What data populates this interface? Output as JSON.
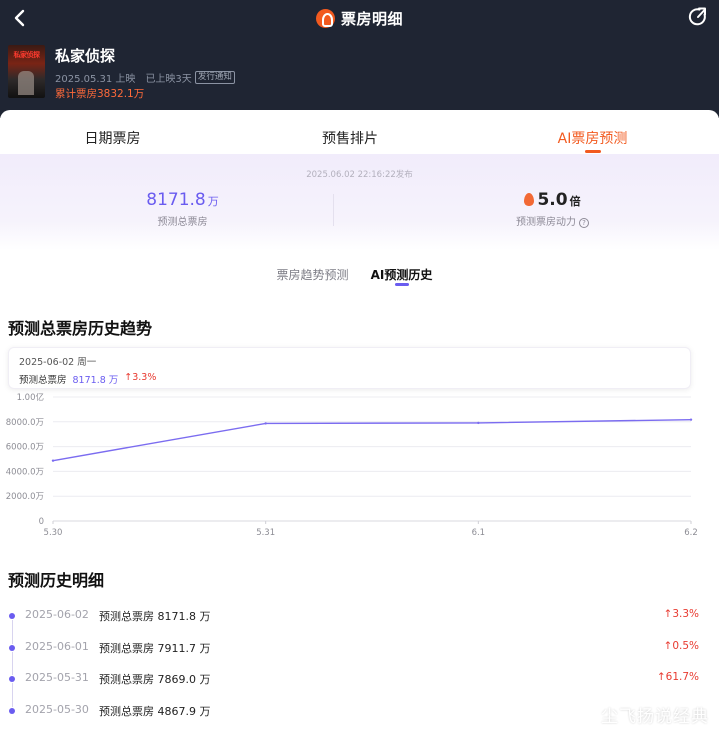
{
  "header": {
    "title": "票房明细",
    "back_icon": "chevron-left-icon",
    "share_icon": "refresh-share-icon",
    "logo_icon": "box-office-logo-icon"
  },
  "movie": {
    "poster_text": "私家侦探",
    "name": "私家侦探",
    "release": "2025.05.31 上映",
    "days": "已上映3天",
    "badge": "发行通知",
    "total": "累计票房3832.1万"
  },
  "tabs": [
    {
      "label": "日期票房",
      "active": false
    },
    {
      "label": "预售排片",
      "active": false
    },
    {
      "label": "AI票房预测",
      "active": true
    }
  ],
  "forecast": {
    "publish_time": "2025.06.02 22:16:22发布",
    "total_value": "8171.8",
    "total_unit": "万",
    "total_label": "预测总票房",
    "multiplier": "5.0",
    "multiplier_unit": "倍",
    "multiplier_label": "预测票房动力",
    "help_glyph": "?"
  },
  "subtabs": [
    {
      "label": "票房趋势预测",
      "active": false
    },
    {
      "label": "AI预测历史",
      "active": true
    }
  ],
  "trend_section_title": "预测总票房历史趋势",
  "tooltip": {
    "date": "2025-06-02 周一",
    "label": "预测总票房",
    "value": "8171.8 万",
    "change": "↑3.3%"
  },
  "chart_data": {
    "type": "line",
    "x": [
      "5.30",
      "5.31",
      "6.1",
      "6.2"
    ],
    "series": [
      {
        "values": [
          4867.9,
          7869.0,
          7911.7,
          8171.8
        ]
      }
    ],
    "y_ticks": [
      "0",
      "2000.0万",
      "4000.0万",
      "6000.0万",
      "8000.0万",
      "1.00亿"
    ],
    "ylim": [
      0,
      10000
    ],
    "grid": true,
    "line_color": "#7b6cf0"
  },
  "detail_section_title": "预测历史明细",
  "history": [
    {
      "date": "2025-06-02",
      "desc": "预测总票房 8171.8 万",
      "change": "↑3.3%"
    },
    {
      "date": "2025-06-01",
      "desc": "预测总票房 7911.7 万",
      "change": "↑0.5%"
    },
    {
      "date": "2025-05-31",
      "desc": "预测总票房 7869.0 万",
      "change": "↑61.7%"
    },
    {
      "date": "2025-05-30",
      "desc": "预测总票房 4867.9 万",
      "change": ""
    }
  ],
  "watermark": "尘飞扬说经典",
  "colors": {
    "accent_orange": "#f25a1f",
    "accent_purple": "#6a5cf0",
    "up_red": "#e83a30",
    "header_bg": "#1f2533"
  }
}
